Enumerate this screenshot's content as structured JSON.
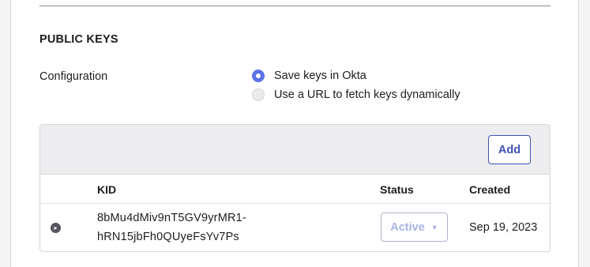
{
  "section": {
    "title": "PUBLIC KEYS"
  },
  "configuration": {
    "label": "Configuration",
    "options": [
      {
        "label": "Save keys in Okta",
        "selected": true
      },
      {
        "label": "Use a URL to fetch keys dynamically",
        "selected": false
      }
    ]
  },
  "table": {
    "add_label": "Add",
    "columns": [
      "KID",
      "Status",
      "Created"
    ],
    "rows": [
      {
        "kid_line1": "8bMu4dMiv9nT5GV9yrMR1-",
        "kid_line2": "hRN15jbFh0QUyeFsYv7Ps",
        "status": "Active",
        "created": "Sep 19, 2023"
      }
    ]
  },
  "colors": {
    "accent": "#3f51b5",
    "radio_selected": "#5a73e8",
    "toolbar_bg": "#ededef",
    "status_disabled_text": "#a9b3e5"
  },
  "icons": {
    "expand": "chevron-right-circle-icon",
    "status_dropdown": "caret-down-icon"
  }
}
